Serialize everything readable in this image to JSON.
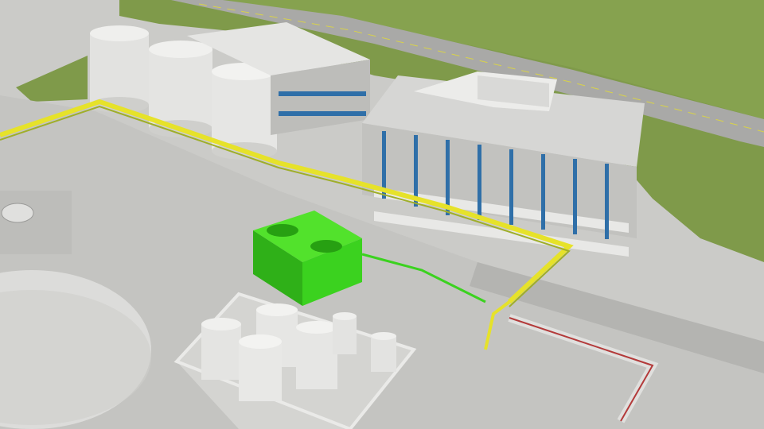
{
  "scene": {
    "subject": "industrial-plant-3d-render",
    "colors": {
      "grass": "#7f9a4a",
      "grass_dark": "#6d8a3c",
      "ground": "#c9c9c6",
      "pavement": "#b9b9b6",
      "road": "#a7a7a5",
      "concrete": "#dcdcda",
      "tank": "#e4e4e2",
      "structure_blue": "#2f6fa8",
      "walkway_yellow": "#e6e22a",
      "cooling_green": "#3bd21f",
      "pipe_red": "#b33a3a"
    }
  }
}
